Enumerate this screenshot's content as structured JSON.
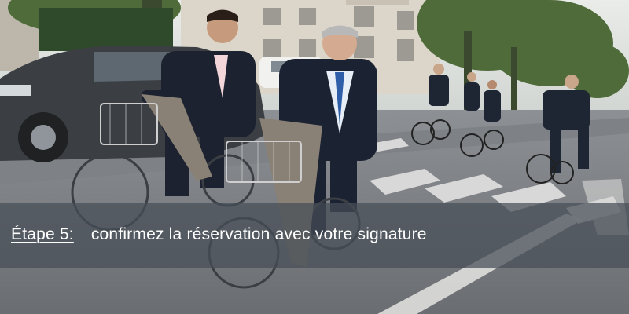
{
  "slide": {
    "step_label": "Étape 5:",
    "step_text": "confirmez la réservation avec votre signature"
  },
  "colors": {
    "caption_bg": "#464e56",
    "caption_text": "#ffffff"
  }
}
